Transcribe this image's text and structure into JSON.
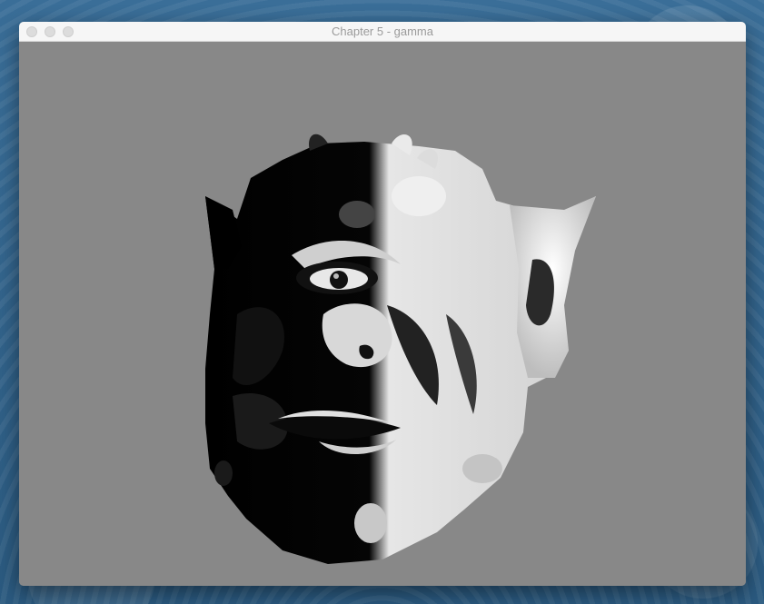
{
  "window": {
    "title": "Chapter 5 - gamma",
    "buttons": [
      "close-button",
      "minimize-button",
      "zoom-button"
    ]
  },
  "viewport": {
    "background_color": "#888888",
    "content": "rendered 3D gargoyle head model with half-lit shading"
  },
  "colors": {
    "titlebar": "#f6f6f6",
    "title_text": "#9b9b9b",
    "desktop": "#2f5f86"
  }
}
